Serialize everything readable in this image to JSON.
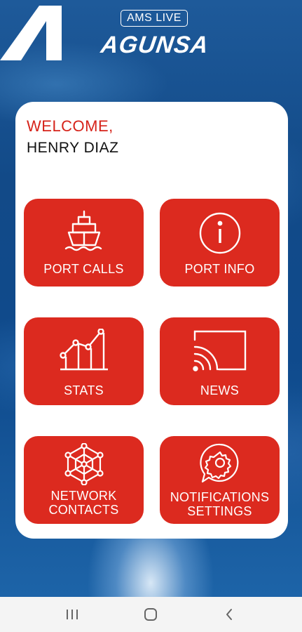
{
  "header": {
    "badge_text": "AMS LIVE",
    "brand_text": "AGUNSA"
  },
  "welcome": {
    "greeting": "WELCOME,",
    "user_name": "HENRY DIAZ"
  },
  "tiles": [
    {
      "label": "PORT CALLS",
      "icon": "ship-icon"
    },
    {
      "label": "PORT INFO",
      "icon": "info-icon"
    },
    {
      "label": "STATS",
      "icon": "line-chart-icon"
    },
    {
      "label": "NEWS",
      "icon": "cast-icon"
    },
    {
      "label": "NETWORK\nCONTACTS",
      "icon": "network-icon"
    },
    {
      "label": "NOTIFICATIONS\nSETTINGS",
      "icon": "gear-bubble-icon"
    }
  ],
  "navbar": {
    "buttons": [
      "recent-apps-icon",
      "home-icon",
      "back-icon"
    ]
  },
  "colors": {
    "accent_red": "#dc2a1f",
    "welcome_red": "#d6231a",
    "ocean_blue": "#124a88",
    "card_white": "#ffffff"
  }
}
